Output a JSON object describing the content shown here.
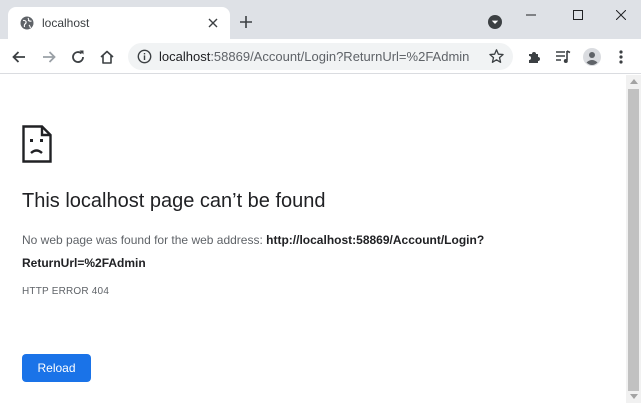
{
  "tab": {
    "title": "localhost",
    "favicon": "globe-icon"
  },
  "window_controls": [
    "minimize-icon",
    "maximize-icon",
    "close-icon"
  ],
  "toolbar": {
    "url_host": "localhost",
    "url_rest": ":58869/Account/Login?ReturnUrl=%2FAdmin",
    "icons": [
      "back-arrow-icon",
      "forward-arrow-icon",
      "reload-icon",
      "home-icon",
      "info-icon",
      "star-icon",
      "puzzle-icon",
      "reading-list-icon",
      "profile-icon",
      "more-vert-icon"
    ]
  },
  "error_page": {
    "icon": "sad-page-icon",
    "heading": "This localhost page can’t be found",
    "message_prefix": "No web page was found for the web address: ",
    "message_url": "http://localhost:58869/Account/Login?ReturnUrl=%2FAdmin",
    "error_code": "HTTP ERROR 404",
    "reload_label": "Reload"
  },
  "colors": {
    "accent": "#1a73e8",
    "tabstrip_bg": "#dee1e6",
    "omnibox_bg": "#f1f3f4",
    "text_primary": "#202124",
    "text_secondary": "#5f6368"
  }
}
